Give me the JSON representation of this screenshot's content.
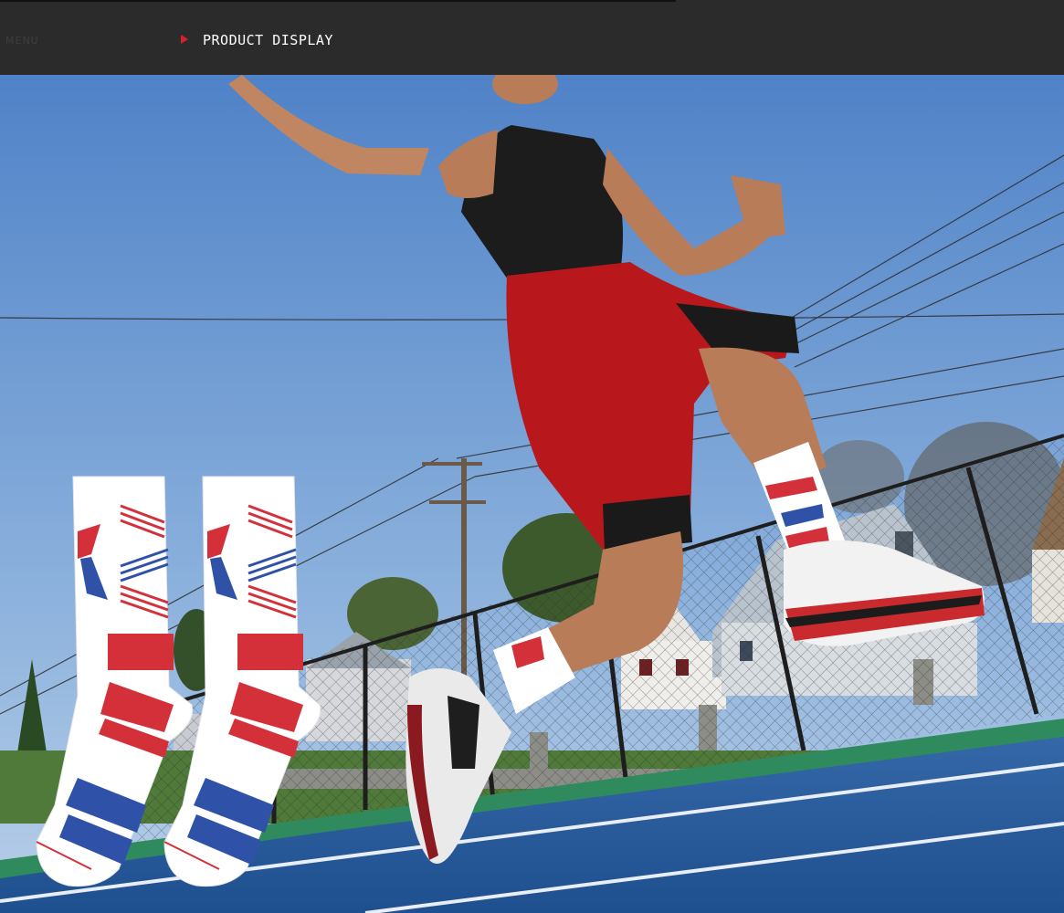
{
  "header": {
    "faint_label": "MENU",
    "title": "PRODUCT DISPLAY"
  },
  "photo": {
    "subject": "basketball-player-jumping",
    "product": "crew-sports-socks"
  },
  "colors": {
    "header_bg": "#2b2b2b",
    "accent_red": "#d8202a",
    "sky": "#5b87c9",
    "court": "#2a5d9e",
    "court_edge": "#2f8a5e"
  }
}
